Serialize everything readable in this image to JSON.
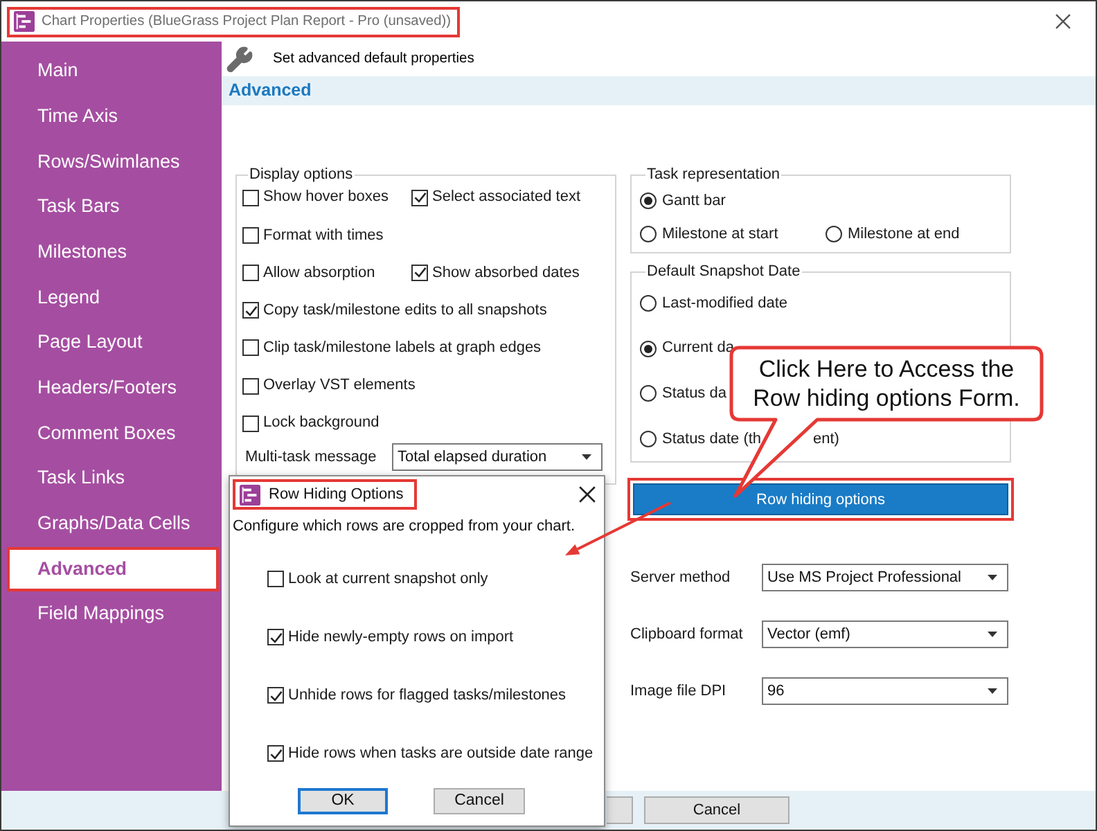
{
  "window": {
    "title": "Chart Properties (BlueGrass Project Plan Report - Pro (unsaved))",
    "highlighted": true
  },
  "sidebar": {
    "items": [
      {
        "label": "Main",
        "selected": false,
        "highlighted": false
      },
      {
        "label": "Time Axis",
        "selected": false,
        "highlighted": false
      },
      {
        "label": "Rows/Swimlanes",
        "selected": false,
        "highlighted": false
      },
      {
        "label": "Task Bars",
        "selected": false,
        "highlighted": false
      },
      {
        "label": "Milestones",
        "selected": false,
        "highlighted": false
      },
      {
        "label": "Legend",
        "selected": false,
        "highlighted": false
      },
      {
        "label": "Page Layout",
        "selected": false,
        "highlighted": false
      },
      {
        "label": "Headers/Footers",
        "selected": false,
        "highlighted": false
      },
      {
        "label": "Comment Boxes",
        "selected": false,
        "highlighted": false
      },
      {
        "label": "Task Links",
        "selected": false,
        "highlighted": false
      },
      {
        "label": "Graphs/Data Cells",
        "selected": false,
        "highlighted": false
      },
      {
        "label": "Advanced",
        "selected": true,
        "highlighted": true
      },
      {
        "label": "Field Mappings",
        "selected": false,
        "highlighted": false
      }
    ]
  },
  "header": {
    "subtitle": "Set advanced default properties",
    "section": "Advanced"
  },
  "display_options": {
    "legend": "Display options",
    "rows": [
      [
        {
          "label": "Show hover boxes",
          "checked": false
        },
        {
          "label": "Select associated text",
          "checked": true
        }
      ],
      [
        {
          "label": "Format with times",
          "checked": false
        }
      ],
      [
        {
          "label": "Allow absorption",
          "checked": false
        },
        {
          "label": "Show absorbed dates",
          "checked": true
        }
      ],
      [
        {
          "label": "Copy task/milestone edits to all snapshots",
          "checked": true
        }
      ],
      [
        {
          "label": "Clip task/milestone labels at graph edges",
          "checked": false
        }
      ],
      [
        {
          "label": "Overlay VST elements",
          "checked": false
        }
      ],
      [
        {
          "label": "Lock background",
          "checked": false
        }
      ]
    ],
    "multi_task_message": {
      "label": "Multi-task message",
      "value": "Total elapsed duration"
    }
  },
  "task_representation": {
    "legend": "Task representation",
    "rows": [
      [
        {
          "label": "Gantt bar",
          "selected": true
        }
      ],
      [
        {
          "label": "Milestone at start",
          "selected": false
        },
        {
          "label": "Milestone at end",
          "selected": false
        }
      ]
    ]
  },
  "default_snapshot_date": {
    "legend": "Default Snapshot Date",
    "options": [
      {
        "label": "Last-modified date",
        "selected": false
      },
      {
        "label": "Current da",
        "selected": true
      },
      {
        "label": "Status da",
        "selected": false
      },
      {
        "label": "Status date (th",
        "label_tail": "ent)",
        "selected": false
      }
    ]
  },
  "row_hiding_button": {
    "label": "Row hiding options",
    "highlighted": true
  },
  "settings": [
    {
      "label": "Server method",
      "value": "Use MS Project Professional"
    },
    {
      "label": "Clipboard format",
      "value": "Vector (emf)"
    },
    {
      "label": "Image file DPI",
      "value": "96"
    }
  ],
  "footer": {
    "buttons": [
      {
        "label": "Cancel"
      }
    ]
  },
  "callout": {
    "text": "Click Here to Access the Row hiding options Form."
  },
  "row_hiding_dialog": {
    "title": "Row Hiding Options",
    "highlighted": true,
    "description": "Configure which rows are cropped from your chart.",
    "options": [
      {
        "label": "Look at current snapshot only",
        "checked": false
      },
      {
        "label": "Hide newly-empty rows on import",
        "checked": true
      },
      {
        "label": "Unhide rows for flagged tasks/milestones",
        "checked": true
      },
      {
        "label": "Hide rows when tasks are outside date range",
        "checked": true
      }
    ],
    "buttons": [
      {
        "label": "OK",
        "default": true
      },
      {
        "label": "Cancel",
        "default": false
      }
    ]
  }
}
